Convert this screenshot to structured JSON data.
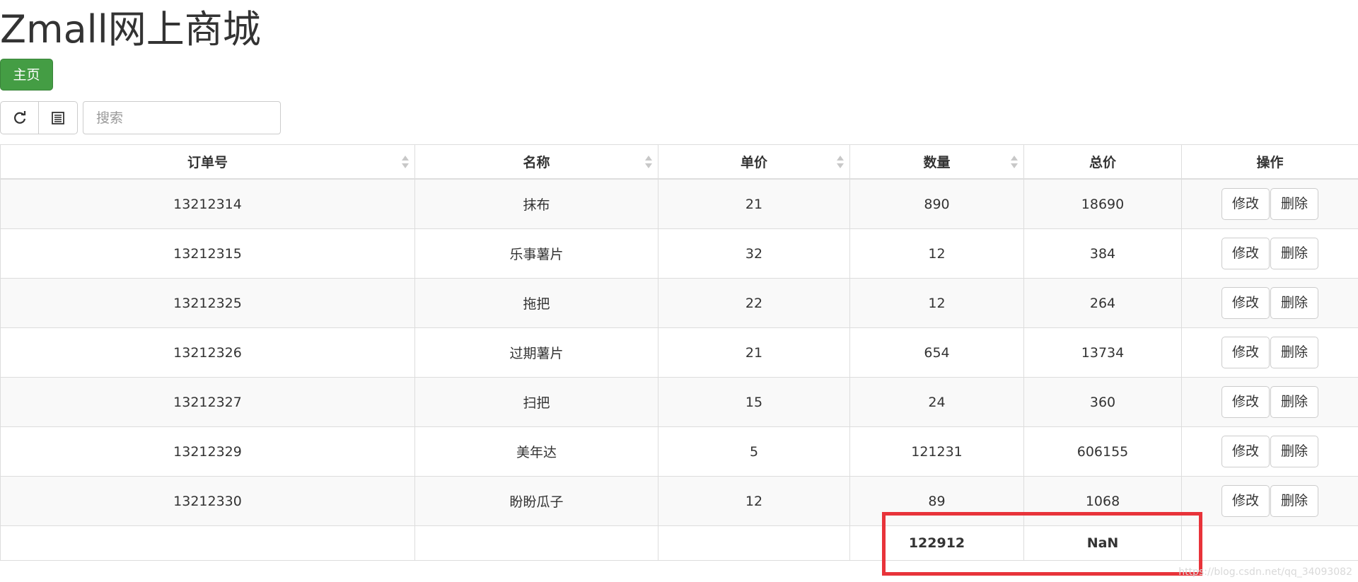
{
  "app": {
    "title": "Zmall网上商城"
  },
  "nav": {
    "home_label": "主页"
  },
  "toolbar": {
    "refresh_icon": "refresh-icon",
    "columns_icon": "columns-list-icon",
    "search_placeholder": "搜索",
    "search_value": ""
  },
  "table": {
    "columns": [
      "订单号",
      "名称",
      "单价",
      "数量",
      "总价",
      "操作"
    ],
    "rows": [
      {
        "order_id": "13212314",
        "name": "抹布",
        "unit_price": "21",
        "quantity": "890",
        "total": "18690"
      },
      {
        "order_id": "13212315",
        "name": "乐事薯片",
        "unit_price": "32",
        "quantity": "12",
        "total": "384"
      },
      {
        "order_id": "13212325",
        "name": "拖把",
        "unit_price": "22",
        "quantity": "12",
        "total": "264"
      },
      {
        "order_id": "13212326",
        "name": "过期薯片",
        "unit_price": "21",
        "quantity": "654",
        "total": "13734"
      },
      {
        "order_id": "13212327",
        "name": "扫把",
        "unit_price": "15",
        "quantity": "24",
        "total": "360"
      },
      {
        "order_id": "13212329",
        "name": "美年达",
        "unit_price": "5",
        "quantity": "121231",
        "total": "606155"
      },
      {
        "order_id": "13212330",
        "name": "盼盼瓜子",
        "unit_price": "12",
        "quantity": "89",
        "total": "1068"
      }
    ],
    "actions": {
      "edit_label": "修改",
      "delete_label": "删除"
    },
    "footer": {
      "quantity_sum": "122912",
      "total_sum": "NaN"
    }
  },
  "annotation": {
    "highlight_color": "#e8333a"
  },
  "watermark": {
    "text": "https://blog.csdn.net/qq_34093082"
  },
  "colors": {
    "primary_green": "#449d44",
    "border": "#dddddd",
    "stripe": "#f9f9f9"
  }
}
